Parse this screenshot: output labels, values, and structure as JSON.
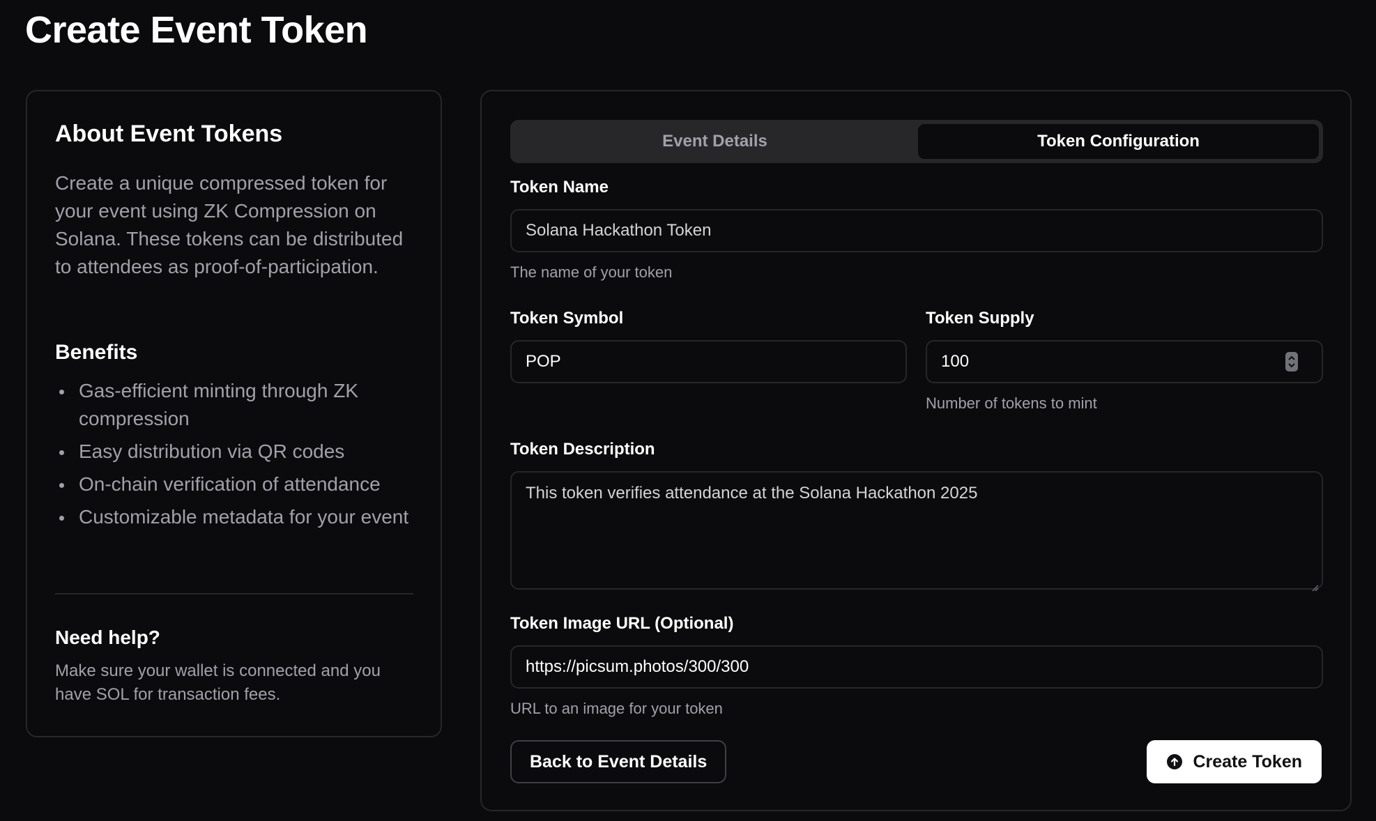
{
  "page": {
    "title": "Create Event Token"
  },
  "about": {
    "title": "About Event Tokens",
    "description": "Create a unique compressed token for your event using ZK Compression on Solana. These tokens can be distributed to attendees as proof-of-participation.",
    "benefits_title": "Benefits",
    "benefits": [
      "Gas-efficient minting through ZK compression",
      "Easy distribution via QR codes",
      "On-chain verification of attendance",
      "Customizable metadata for your event"
    ],
    "help_title": "Need help?",
    "help_text": "Make sure your wallet is connected and you have SOL for transaction fees."
  },
  "tabs": [
    {
      "label": "Event Details",
      "active": false
    },
    {
      "label": "Token Configuration",
      "active": true
    }
  ],
  "form": {
    "token_name": {
      "label": "Token Name",
      "value": "Solana Hackathon Token",
      "hint": "The name of your token"
    },
    "token_symbol": {
      "label": "Token Symbol",
      "value": "POP"
    },
    "token_supply": {
      "label": "Token Supply",
      "value": "100",
      "hint": "Number of tokens to mint"
    },
    "token_description": {
      "label": "Token Description",
      "value": "This token verifies attendance at the Solana Hackathon 2025"
    },
    "token_image": {
      "label": "Token Image URL (Optional)",
      "value": "https://picsum.photos/300/300",
      "hint": "URL to an image for your token"
    }
  },
  "actions": {
    "back_label": "Back to Event Details",
    "create_label": "Create Token",
    "create_icon": "arrow-up-circle-icon"
  },
  "colors": {
    "background": "#0b0b0d",
    "border": "#27272a",
    "muted_text": "#a1a1aa",
    "primary_button": "#ffffff"
  }
}
